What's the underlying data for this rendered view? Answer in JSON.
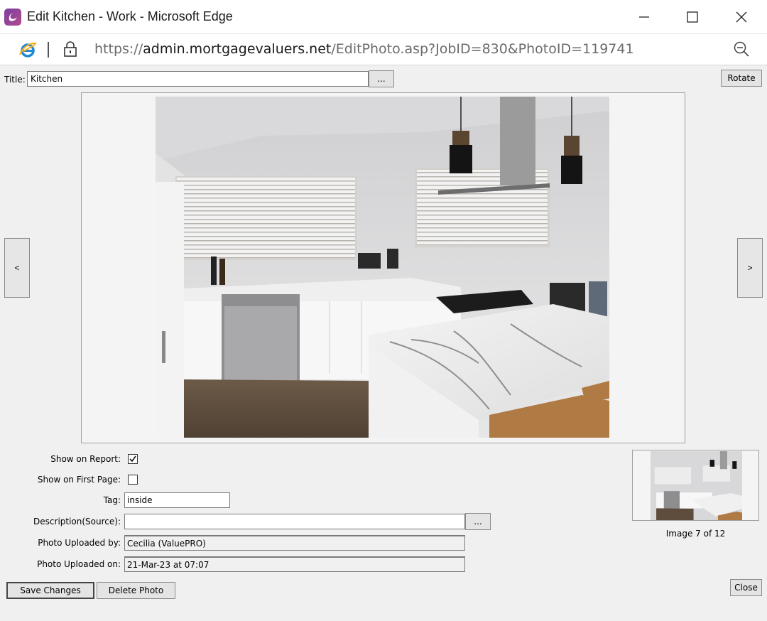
{
  "window": {
    "title": "Edit Kitchen - Work - Microsoft Edge",
    "url_scheme": "https://",
    "url_host": "admin.mortgagevaluers.net",
    "url_path": "/EditPhoto.asp?JobID=830&PhotoID=119741"
  },
  "form": {
    "title_label": "Title:",
    "title_value": "Kitchen",
    "browse_label": "...",
    "rotate_label": "Rotate",
    "prev_label": "<",
    "next_label": ">",
    "show_on_report_label": "Show on Report:",
    "show_on_report_checked": true,
    "show_first_page_label": "Show on First Page:",
    "show_first_page_checked": false,
    "tag_label": "Tag:",
    "tag_value": "inside",
    "description_label": "Description(Source):",
    "description_value": "",
    "description_browse_label": "...",
    "uploaded_by_label": "Photo Uploaded by:",
    "uploaded_by_value": "Cecilia (ValuePRO)",
    "uploaded_on_label": "Photo Uploaded on:",
    "uploaded_on_value": "21-Mar-23 at 07:07",
    "image_count": "Image 7 of 12",
    "save_label": "Save Changes",
    "delete_label": "Delete Photo",
    "close_label": "Close"
  },
  "icons": {
    "app": "edge-app-icon",
    "minimize": "minimize-icon",
    "maximize": "maximize-icon",
    "close": "close-icon",
    "ie": "ie-compat-icon",
    "lock": "lock-icon",
    "zoom": "zoom-out-icon"
  }
}
